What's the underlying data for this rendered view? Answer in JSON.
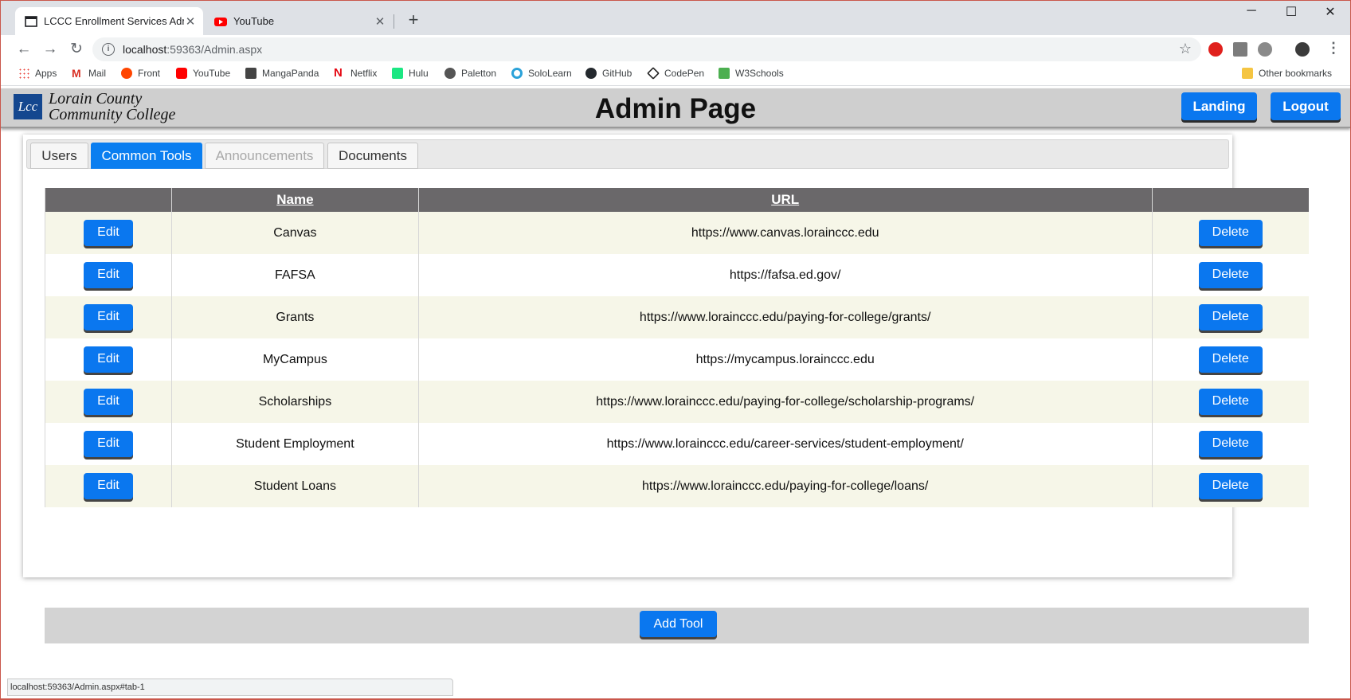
{
  "browser": {
    "tabs": [
      {
        "title": "LCCC Enrollment Services Admin",
        "icon": "page-icon"
      },
      {
        "title": "YouTube",
        "icon": "youtube-icon"
      }
    ],
    "url_host": "localhost",
    "url_path": ":59363/Admin.aspx",
    "bookmarks": [
      "Apps",
      "Mail",
      "Front",
      "YouTube",
      "MangaPanda",
      "Netflix",
      "Hulu",
      "Paletton",
      "SoloLearn",
      "GitHub",
      "CodePen",
      "W3Schools"
    ],
    "other_bookmarks": "Other bookmarks",
    "status_url": "localhost:59363/Admin.aspx#tab-1"
  },
  "header": {
    "logo_mark": "Lcc",
    "logo_line1": "Lorain County",
    "logo_line2": "Community College",
    "title": "Admin Page",
    "landing_label": "Landing",
    "logout_label": "Logout"
  },
  "tabs": [
    {
      "label": "Users",
      "state": "normal"
    },
    {
      "label": "Common Tools",
      "state": "active"
    },
    {
      "label": "Announcements",
      "state": "disabled"
    },
    {
      "label": "Documents",
      "state": "normal"
    }
  ],
  "table": {
    "columns": [
      "",
      "Name",
      "URL",
      ""
    ],
    "edit_label": "Edit",
    "delete_label": "Delete",
    "rows": [
      {
        "name": "Canvas",
        "url": "https://www.canvas.lorainccc.edu"
      },
      {
        "name": "FAFSA",
        "url": "https://fafsa.ed.gov/"
      },
      {
        "name": "Grants",
        "url": "https://www.lorainccc.edu/paying-for-college/grants/"
      },
      {
        "name": "MyCampus",
        "url": "https://mycampus.lorainccc.edu"
      },
      {
        "name": "Scholarships",
        "url": "https://www.lorainccc.edu/paying-for-college/scholarship-programs/"
      },
      {
        "name": "Student Employment",
        "url": "https://www.lorainccc.edu/career-services/student-employment/"
      },
      {
        "name": "Student Loans",
        "url": "https://www.lorainccc.edu/paying-for-college/loans/"
      }
    ]
  },
  "add_tool_label": "Add Tool",
  "colors": {
    "accent": "#0a77ef",
    "header_bg": "#cfcfcf",
    "table_header": "#6a686a",
    "row_alt": "#f6f6e8",
    "logo": "#14478f"
  }
}
